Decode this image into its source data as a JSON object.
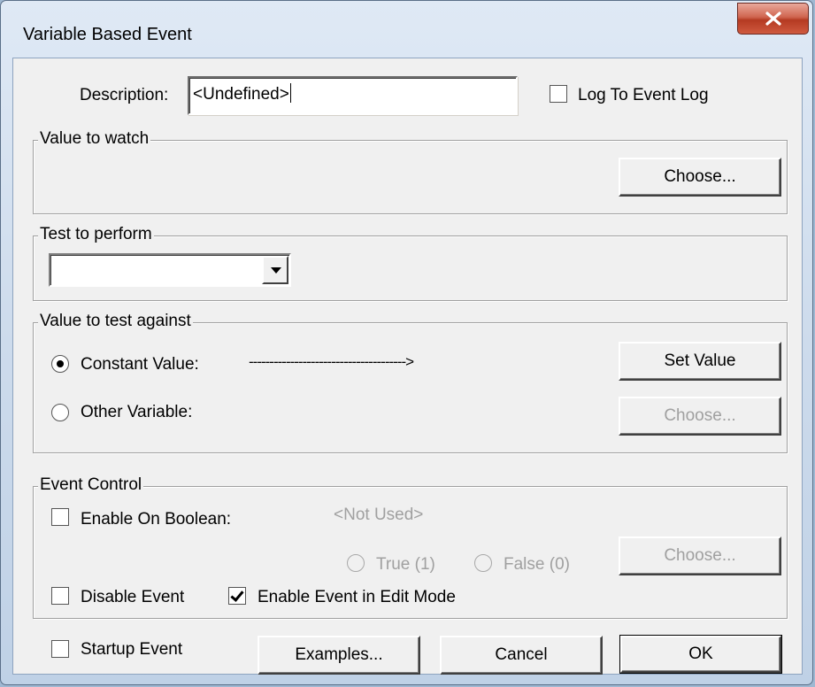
{
  "window": {
    "title": "Variable Based Event"
  },
  "description": {
    "label": "Description:",
    "value": "<Undefined>"
  },
  "log_to_event_log": {
    "label": "Log To Event Log",
    "checked": false
  },
  "value_to_watch": {
    "legend": "Value to watch",
    "choose_label": "Choose..."
  },
  "test_to_perform": {
    "legend": "Test to perform",
    "selected": ""
  },
  "value_to_test": {
    "legend": "Value to test against",
    "constant_label": "Constant Value:",
    "arrow_text": "-------------------------------------->",
    "other_label": "Other Variable:",
    "set_value_label": "Set Value",
    "choose_label": "Choose...",
    "selected": "constant"
  },
  "event_control": {
    "legend": "Event Control",
    "enable_on_boolean_label": "Enable On Boolean:",
    "not_used_text": "<Not Used>",
    "true_label": "True (1)",
    "false_label": "False (0)",
    "choose_label": "Choose...",
    "disable_event_label": "Disable Event",
    "enable_edit_mode_label": "Enable Event in Edit Mode",
    "enable_edit_mode_checked": true
  },
  "footer": {
    "startup_event_label": "Startup Event",
    "examples_label": "Examples...",
    "cancel_label": "Cancel",
    "ok_label": "OK"
  }
}
